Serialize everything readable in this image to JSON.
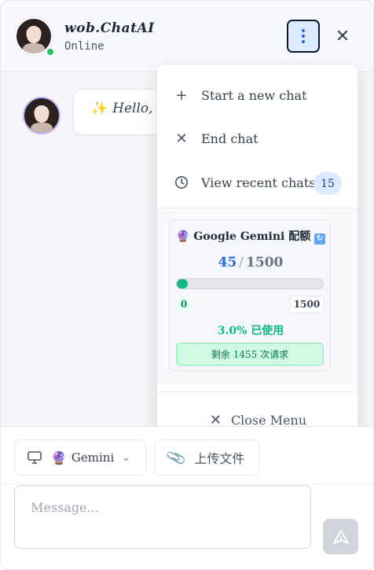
{
  "header": {
    "title": "wob.ChatAI",
    "status": "Online",
    "menu_icon": "vertical-dots-icon",
    "close_icon": "close-icon"
  },
  "chat": {
    "messages": [
      {
        "emoji": "✨",
        "text": "Hello, "
      }
    ]
  },
  "menu": {
    "items": [
      {
        "icon": "plus-icon",
        "glyph": "+",
        "label": "Start a new chat"
      },
      {
        "icon": "close-icon",
        "glyph": "✕",
        "label": "End chat"
      },
      {
        "icon": "clock-icon",
        "glyph": "",
        "label": "View recent chats",
        "badge": "15"
      }
    ],
    "quota": {
      "icon": "crystal-ball-icon",
      "title": "Google Gemini 配额",
      "used": "45",
      "separator": "/",
      "total": "1500",
      "progress_fraction": 0.03,
      "min_label": "0",
      "max_label": "1500",
      "percent_text": "3.0% 已使用",
      "remaining_text": "剩余 1455 次请求"
    },
    "close_label": "Close Menu"
  },
  "composer": {
    "model_label": "Gemini",
    "upload_label": "上传文件",
    "placeholder": "Message..."
  },
  "colors": {
    "accent": "#2563eb",
    "success": "#10b981",
    "online": "#22c55e"
  }
}
